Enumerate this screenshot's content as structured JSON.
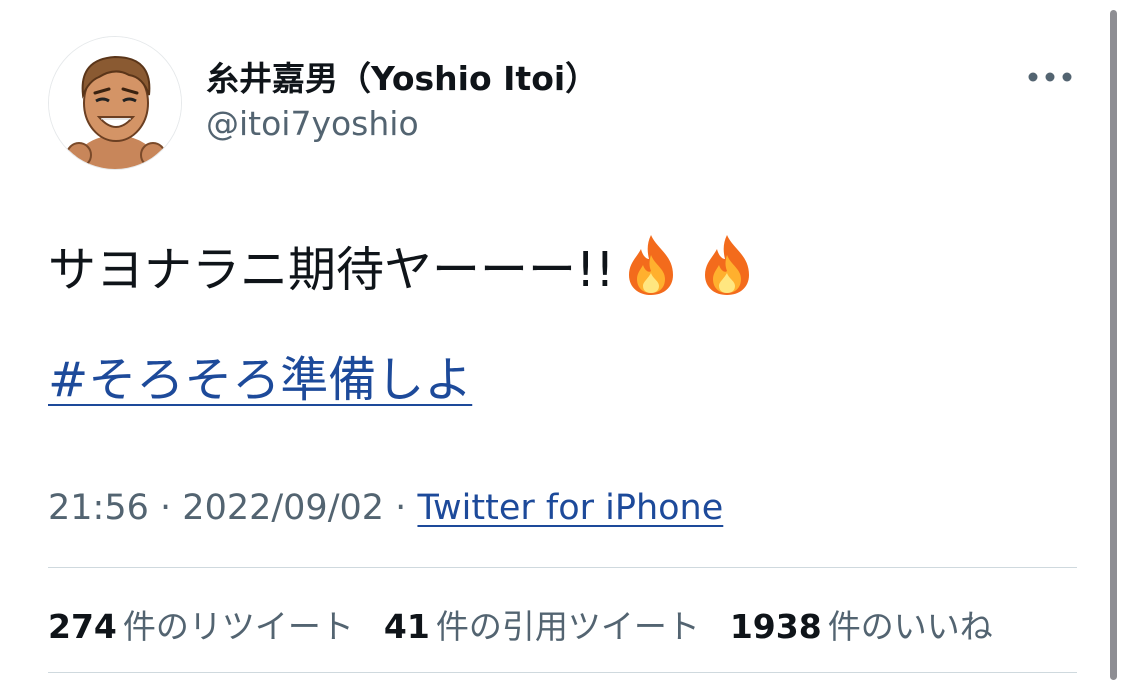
{
  "user": {
    "display_name": "糸井嘉男（Yoshio Itoi）",
    "handle": "@itoi7yoshio",
    "avatar_icon": "cartoon-avatar"
  },
  "tweet": {
    "text": "サヨナラニ期待ヤーーー!!",
    "emoji_icon": "fire-emoji",
    "hashtag": "#そろそろ準備しよ"
  },
  "meta": {
    "time": "21:56",
    "separator": "·",
    "date": "2022/09/02",
    "source": "Twitter for iPhone"
  },
  "stats": {
    "retweets_count": "274",
    "retweets_label": "件のリツイート",
    "quotes_count": "41",
    "quotes_label": "件の引用ツイート",
    "likes_count": "1938",
    "likes_label": "件のいいね"
  },
  "colors": {
    "link": "#1d4a9a",
    "secondary_text": "#536471",
    "primary_text": "#0f1419"
  }
}
